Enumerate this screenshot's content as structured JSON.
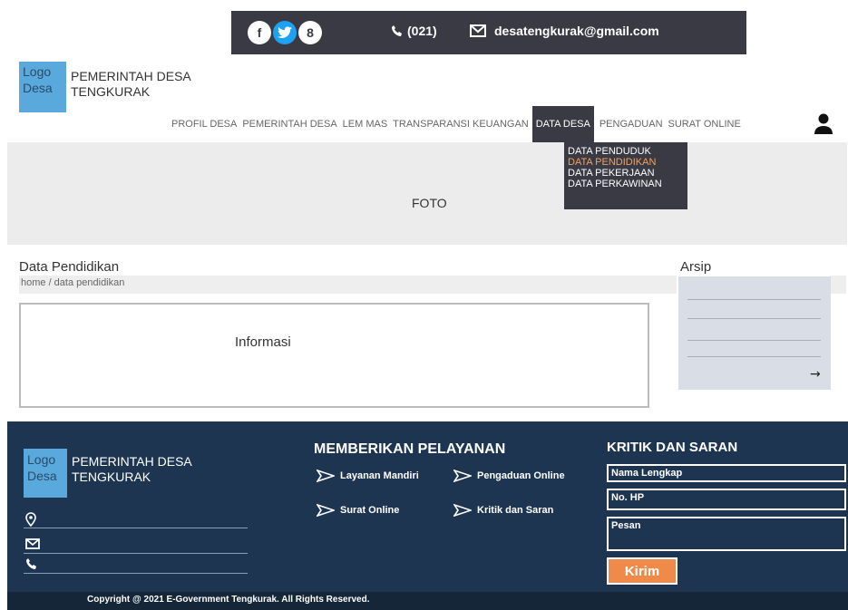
{
  "topbar": {
    "social_icons": [
      "facebook-icon",
      "twitter-icon",
      "pinterest-icon"
    ],
    "phone": "(021)",
    "email": "desatengkurak@gmail.com"
  },
  "header": {
    "logo_text": "Logo Desa",
    "site_name": "PEMERINTAH DESA TENGKURAK"
  },
  "nav": {
    "items": [
      "PROFIL DESA",
      "PEMERINTAH DESA",
      "LEM MAS",
      "TRANSPARANSI KEUANGAN",
      "DATA DESA",
      "PENGADUAN",
      "SURAT ONLINE"
    ],
    "active": "DATA DESA"
  },
  "dropdown": {
    "items": [
      "DATA PENDUDUK",
      "DATA PENDIDIKAN",
      "DATA PEKERJAAN",
      "DATA PERKAWINAN"
    ],
    "highlighted": "DATA PENDIDIKAN",
    "highlight_color": "#f0a060"
  },
  "hero": {
    "label": "FOTO"
  },
  "content": {
    "title": "Data Pendidikan",
    "breadcrumb": "home / data pendidikan",
    "info": "Informasi"
  },
  "sidebar": {
    "title": "Arsip",
    "arrow": "→"
  },
  "footer": {
    "logo_text": "Logo Desa",
    "site_name": "PEMERINTAH DESA TENGKURAK",
    "services_title": "MEMBERIKAN PELAYANAN",
    "services": [
      "Layanan Mandiri",
      "Pengaduan Online",
      "Surat Online",
      "Kritik dan Saran"
    ],
    "feedback_title": "KRITIK DAN SARAN",
    "fields": {
      "name_placeholder": "Nama Lengkap",
      "phone_placeholder": "No. HP",
      "message_placeholder": "Pesan"
    },
    "submit_label": "Kirim",
    "copyright": "Copyright @ 2021 E-Government Tengkurak. All Rights Reserved."
  },
  "colors": {
    "topbar": "#3a3a44",
    "footer": "#1e3552",
    "logo": "#5aa9dc",
    "button": "#f08a4a"
  }
}
